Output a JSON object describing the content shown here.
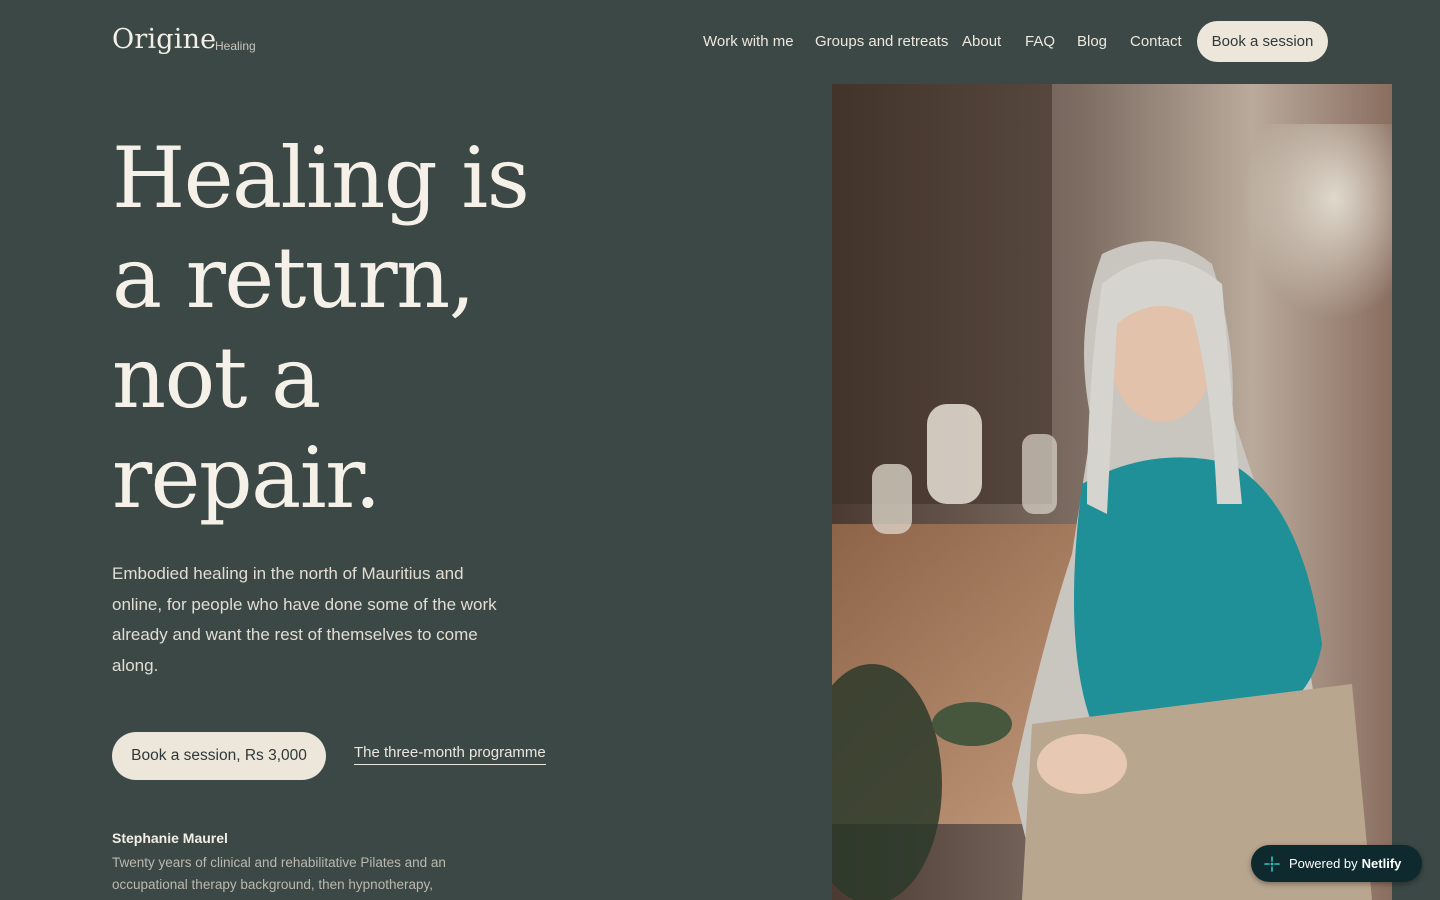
{
  "brand": {
    "name": "Origine",
    "tag": "Healing"
  },
  "nav": {
    "items": [
      {
        "label": "Work with me"
      },
      {
        "label": "Groups and retreats"
      },
      {
        "label": "About"
      },
      {
        "label": "FAQ"
      },
      {
        "label": "Blog"
      },
      {
        "label": "Contact"
      }
    ],
    "cta": "Book a session"
  },
  "hero": {
    "headline_lines": [
      "Healing is",
      "a return,",
      "not a",
      "repair."
    ],
    "lead": "Embodied healing in the north of Mauritius and online, for people who have done some of the work already and want the rest of themselves to come along.",
    "primary_cta": "Book a session, Rs 3,000",
    "secondary_cta": "The three-month programme"
  },
  "bio": {
    "name": "Stephanie Maurel",
    "text": "Twenty years of clinical and rehabilitative Pilates and an occupational therapy background, then hypnotherapy,"
  },
  "badge": {
    "prefix": "Powered by",
    "brand": "Netlify",
    "icon": "netlify-sparkle-icon"
  },
  "colors": {
    "background": "#3b4846",
    "button_bg": "#ece6db",
    "text": "#f6f1e8",
    "badge_bg": "#0f2a2e",
    "accent": "#1f9aa0"
  }
}
